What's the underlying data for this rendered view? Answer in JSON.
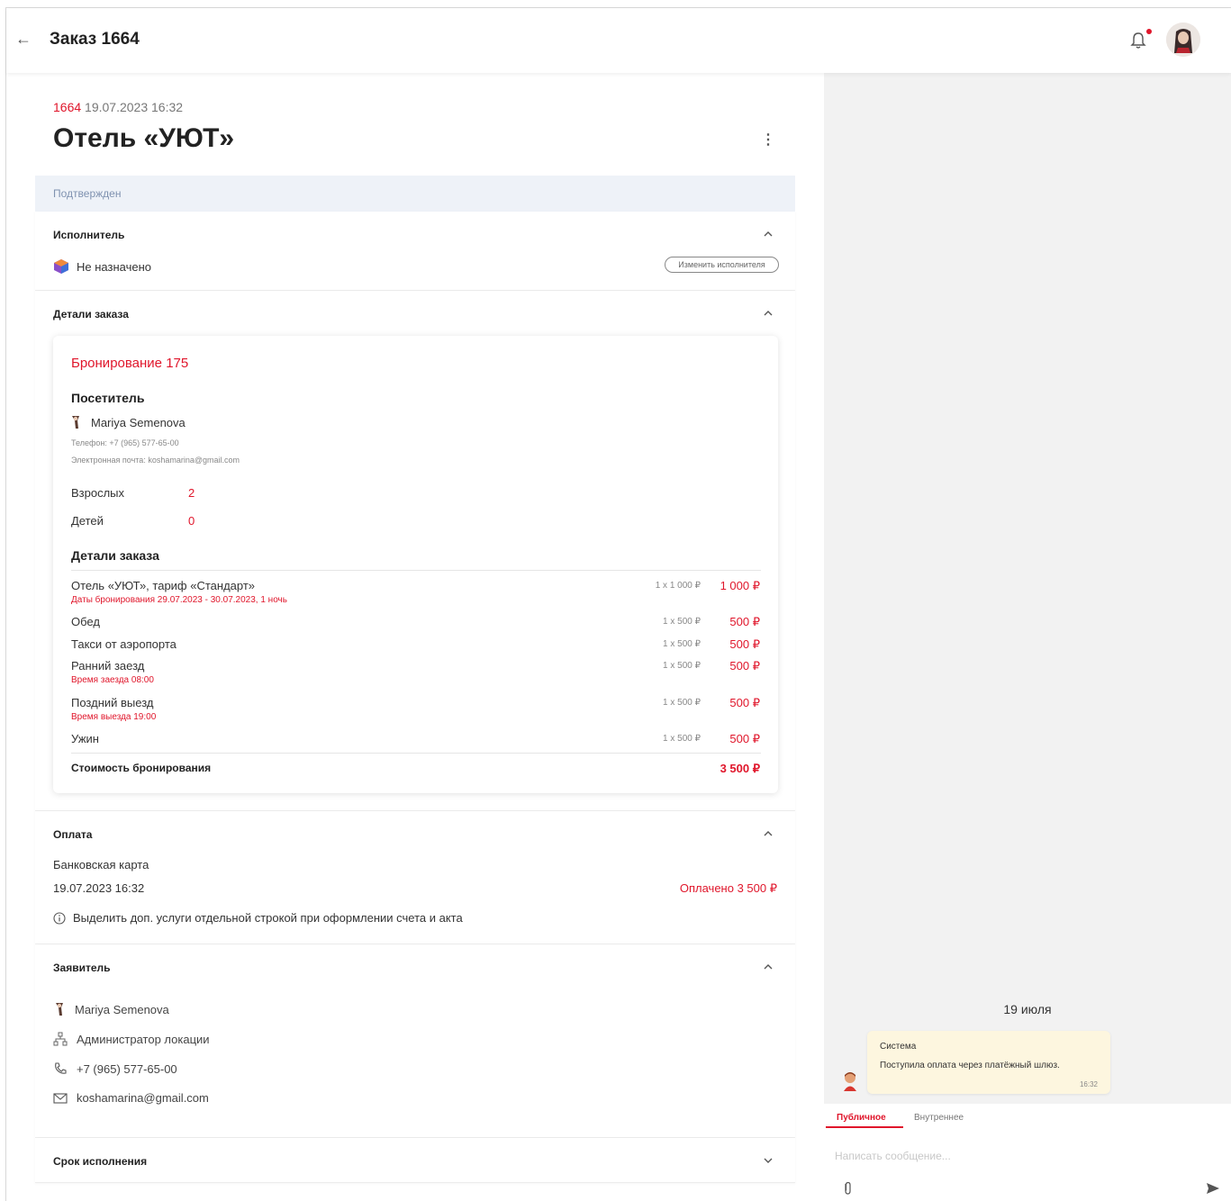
{
  "header": {
    "back_icon": "arrow-left-icon",
    "title": "Заказ 1664"
  },
  "order": {
    "number": "1664",
    "datetime": "19.07.2023 16:32",
    "title": "Отель «УЮТ»",
    "status": "Подтвержден"
  },
  "executor": {
    "section_title": "Исполнитель",
    "value": "Не назначено",
    "change_button": "Изменить исполнителя"
  },
  "details": {
    "section_title": "Детали заказа",
    "booking_title": "Бронирование 175",
    "visitor_heading": "Посетитель",
    "visitor_name": "Mariya Semenova",
    "phone_line": "Телефон: +7 (965) 577-65-00",
    "email_line": "Электронная почта: koshamarina@gmail.com",
    "adults_label": "Взрослых",
    "adults_value": "2",
    "children_label": "Детей",
    "children_value": "0",
    "order_details_heading": "Детали заказа",
    "items": [
      {
        "name": "Отель «УЮТ», тариф «Стандарт»",
        "note": "Даты бронирования 29.07.2023 - 30.07.2023, 1 ночь",
        "qty": "1 x 1 000 ₽",
        "price": "1 000 ₽"
      },
      {
        "name": "Обед",
        "note": "",
        "qty": "1 x 500 ₽",
        "price": "500 ₽"
      },
      {
        "name": "Такси от аэропорта",
        "note": "",
        "qty": "1 x 500 ₽",
        "price": "500 ₽"
      },
      {
        "name": "Ранний заезд",
        "note": "Время заезда 08:00",
        "qty": "1 x 500 ₽",
        "price": "500 ₽"
      },
      {
        "name": "Поздний выезд",
        "note": "Время выезда 19:00",
        "qty": "1 x 500 ₽",
        "price": "500 ₽"
      },
      {
        "name": "Ужин",
        "note": "",
        "qty": "1 x 500 ₽",
        "price": "500 ₽"
      }
    ],
    "total_label": "Стоимость бронирования",
    "total_value": "3 500 ₽"
  },
  "payment": {
    "section_title": "Оплата",
    "method": "Банковская карта",
    "datetime": "19.07.2023 16:32",
    "paid": "Оплачено 3 500 ₽",
    "info": "Выделить доп. услуги отдельной строкой при оформлении счета и акта"
  },
  "applicant": {
    "section_title": "Заявитель",
    "name": "Mariya Semenova",
    "role": "Администратор локации",
    "phone": "+7 (965) 577-65-00",
    "email": "koshamarina@gmail.com"
  },
  "deadline": {
    "section_title": "Срок исполнения"
  },
  "chat": {
    "date": "19 июля",
    "message": {
      "author": "Система",
      "text": "Поступила оплата через платёжный шлюз.",
      "time": "16:32"
    },
    "tabs": [
      "Публичное",
      "Внутреннее"
    ],
    "placeholder": "Написать сообщение..."
  },
  "colors": {
    "accent": "#e0162b",
    "status_bg": "#eef2f8",
    "status_text": "#7f92b0",
    "chat_bg": "#f2f2f2",
    "bubble_bg": "#fdf6df"
  }
}
